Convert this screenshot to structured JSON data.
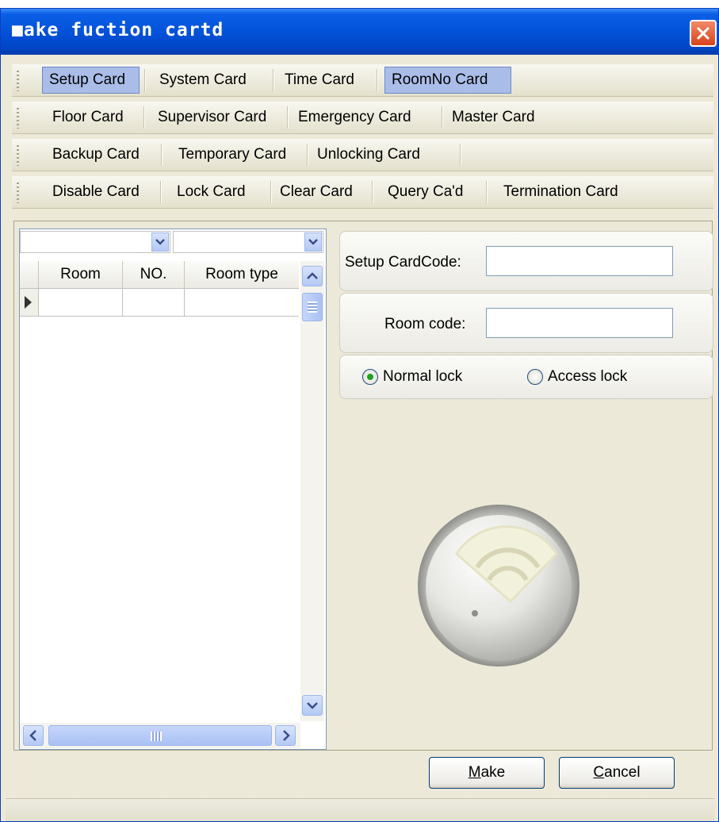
{
  "window": {
    "title": "Make fuction cartd",
    "title_icon_char": "■",
    "title_rest": "ake fuction cartd"
  },
  "toolbars": [
    {
      "items": [
        {
          "label": "Setup Card",
          "active": true
        },
        {
          "label": "System Card"
        },
        {
          "label": "Time Card"
        },
        {
          "label": "RoomNo Card",
          "active": true
        }
      ]
    },
    {
      "items": [
        {
          "label": "Floor Card"
        },
        {
          "label": "Supervisor Card"
        },
        {
          "label": "Emergency Card"
        },
        {
          "label": "Master Card"
        }
      ]
    },
    {
      "items": [
        {
          "label": "Backup Card"
        },
        {
          "label": "Temporary Card"
        },
        {
          "label": "Unlocking Card"
        }
      ]
    },
    {
      "items": [
        {
          "label": "Disable Card"
        },
        {
          "label": "Lock Card"
        },
        {
          "label": "Clear Card"
        },
        {
          "label": "Query Ca'd"
        },
        {
          "label": "Termination Card"
        }
      ]
    }
  ],
  "grid": {
    "combo1_value": "",
    "combo2_value": "",
    "columns": [
      "Room",
      "NO.",
      "Room type"
    ],
    "rows": [
      [
        "",
        "",
        ""
      ]
    ]
  },
  "form": {
    "setup_code_label": "Setup CardCode:",
    "setup_code_value": "",
    "room_code_label": "Room code:",
    "room_code_value": "",
    "lock_options": [
      {
        "label": "Normal lock",
        "checked": true
      },
      {
        "label": "Access lock",
        "checked": false
      }
    ]
  },
  "buttons": {
    "make_hotkey": "M",
    "make_rest": "ake",
    "cancel_hotkey": "C",
    "cancel_rest": "ancel"
  },
  "icons": {
    "logo": "card-reader-icon"
  },
  "colors": {
    "title_bar": "#0352d8",
    "active_tab": "#a9bde8",
    "radio_checked": "#21a121"
  }
}
